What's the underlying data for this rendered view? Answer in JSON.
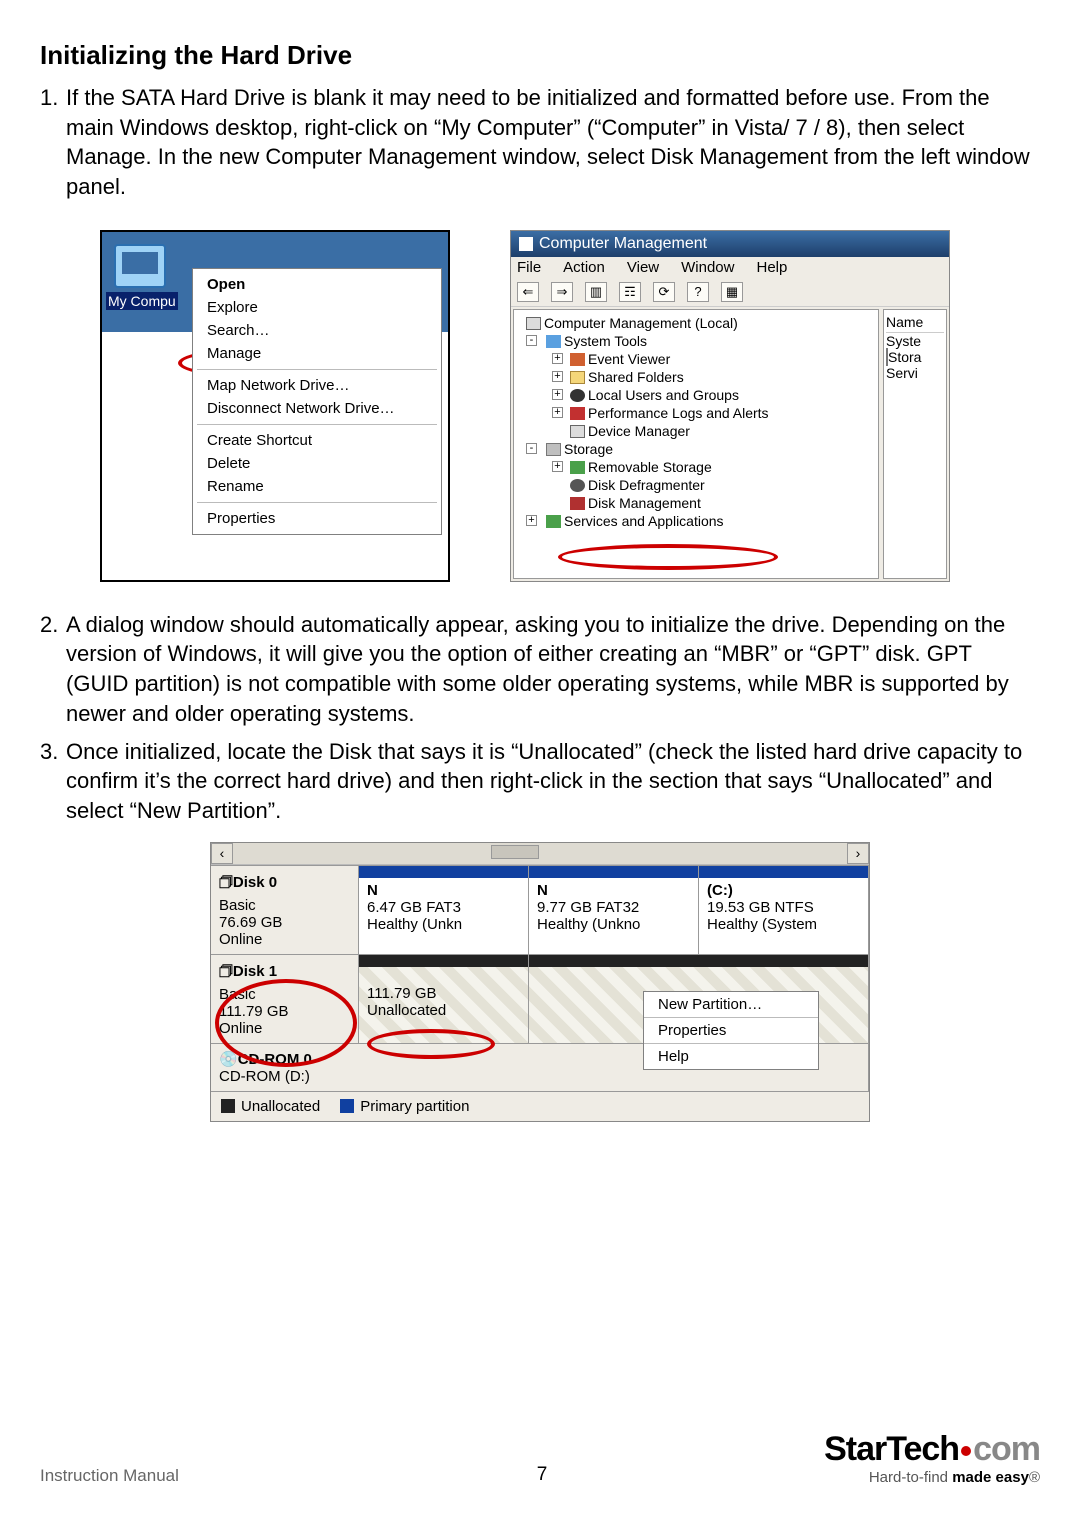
{
  "heading": "Initializing the Hard Drive",
  "steps": [
    {
      "num": "1.",
      "text": "If the SATA Hard Drive is blank it may need to be initialized and formatted before use. From the main Windows desktop, right-click on “My Computer” (“Computer” in Vista/ 7 / 8), then select Manage. In the new Computer Management window, select Disk Management from the left window panel."
    },
    {
      "num": "2.",
      "text": "A dialog window should automatically appear, asking you to initialize the drive. Depending on the version of Windows, it will give you the option of either creating an “MBR” or “GPT” disk. GPT (GUID partition) is not compatible with some older operating systems, while MBR is supported by newer and older operating systems."
    },
    {
      "num": "3.",
      "text": "Once initialized, locate the Disk that says it is “Unallocated” (check the listed hard drive capacity to confirm it’s the correct hard drive) and then right-click in the section that says “Unallocated” and select “New Partition”."
    }
  ],
  "fig1": {
    "iconLabel": "My Compu",
    "menu": {
      "open": "Open",
      "explore": "Explore",
      "search": "Search…",
      "manage": "Manage",
      "map": "Map Network Drive…",
      "disconnect": "Disconnect Network Drive…",
      "shortcut": "Create Shortcut",
      "delete": "Delete",
      "rename": "Rename",
      "properties": "Properties"
    }
  },
  "fig2": {
    "title": "Computer Management",
    "menus": {
      "file": "File",
      "action": "Action",
      "view": "View",
      "window": "Window",
      "help": "Help"
    },
    "tree": {
      "root": "Computer Management (Local)",
      "systools": "System Tools",
      "ev": "Event Viewer",
      "sf": "Shared Folders",
      "lu": "Local Users and Groups",
      "pl": "Performance Logs and Alerts",
      "dm": "Device Manager",
      "storage": "Storage",
      "rs": "Removable Storage",
      "dd": "Disk Defragmenter",
      "dk": "Disk Management",
      "sa": "Services and Applications"
    },
    "right": {
      "name": "Name",
      "syste": "Syste",
      "stora": "Stora",
      "servi": "Servi"
    }
  },
  "fig3": {
    "disk0": {
      "hd": "Disk 0",
      "type": "Basic",
      "size": "76.69 GB",
      "status": "Online"
    },
    "d0p1": {
      "l1": "N",
      "l2": "6.47 GB FAT3",
      "l3": "Healthy (Unkn"
    },
    "d0p2": {
      "l1": "N",
      "l2": "9.77 GB FAT32",
      "l3": "Healthy (Unkno"
    },
    "d0p3": {
      "l1": "(C:)",
      "l2": "19.53 GB NTFS",
      "l3": "Healthy (System"
    },
    "disk1": {
      "hd": "Disk 1",
      "type": "Basic",
      "size": "111.79 GB",
      "status": "Online"
    },
    "d1p1": {
      "l2": "111.79 GB",
      "l3": "Unallocated"
    },
    "cd": {
      "hd": "CD-ROM 0",
      "sub": "CD-ROM (D:)"
    },
    "ctx": {
      "np": "New Partition…",
      "prop": "Properties",
      "help": "Help"
    },
    "legend": {
      "un": "Unallocated",
      "pp": "Primary partition"
    }
  },
  "footer": {
    "im": "Instruction Manual",
    "page": "7",
    "brand1": "StarTech",
    "brand2": "com",
    "tag1": "Hard-to-find ",
    "tag2": "made easy",
    "reg": "®"
  }
}
